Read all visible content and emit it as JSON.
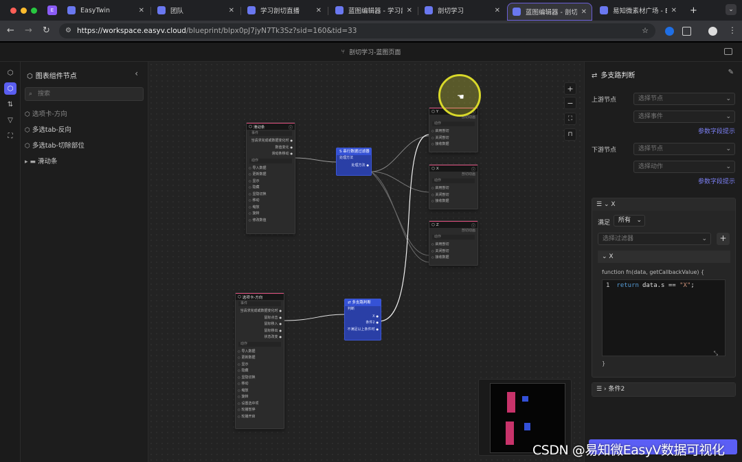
{
  "browser": {
    "tabs": [
      {
        "title": "",
        "favicon_text": "E",
        "favicon_color": "#8b5cf6"
      },
      {
        "title": "EasyTwin",
        "favicon_text": "",
        "favicon_color": "#6a78f0"
      },
      {
        "title": "团队",
        "favicon_text": "",
        "favicon_color": "#6a78f0"
      },
      {
        "title": "学习剖切直播",
        "favicon_text": "",
        "favicon_color": "#6a78f0"
      },
      {
        "title": "蓝图编辑器 - 学习剖切",
        "favicon_text": "",
        "favicon_color": "#6a78f0"
      },
      {
        "title": "剖切学习",
        "favicon_text": "",
        "favicon_color": "#6a78f0"
      },
      {
        "title": "蓝图编辑器 - 剖切学",
        "favicon_text": "",
        "favicon_color": "#6a78f0"
      },
      {
        "title": "易知微素材广场 - Ea",
        "favicon_text": "",
        "favicon_color": "#6a78f0"
      }
    ],
    "new_tab": "+",
    "url_host": "https://workspace.easyv.cloud",
    "url_rest": "/blueprint/blpx0pJ7jyN7Tk3Sz?sid=160&tid=33"
  },
  "app": {
    "page_title": "剖切学习-蓝图页面",
    "left_panel": {
      "title": "图表组件节点",
      "search_placeholder": "搜索",
      "items": [
        {
          "label": "选项卡-方向"
        },
        {
          "label": "多选tab-反向"
        },
        {
          "label": "多选tab-切除部位"
        },
        {
          "label": "滑动条"
        }
      ]
    },
    "nodes": {
      "slider": {
        "title": "滑动条",
        "events_label": "事件",
        "events": [
          "当请求完成或数据变化时",
          "数值变化",
          "滑动条移动"
        ],
        "actions_label": "动作",
        "actions": [
          "导入数据",
          "更新数据",
          "显示",
          "隐藏",
          "显隐切换",
          "移动",
          "缩放",
          "旋转",
          "修改数值"
        ]
      },
      "tabs": {
        "title": "选项卡-方向",
        "events_label": "事件",
        "events": [
          "当请求完成或数据变化时",
          "鼠标点击",
          "鼠标移入",
          "鼠标移出",
          "状态改变"
        ],
        "actions_label": "动作",
        "actions": [
          "导入数据",
          "更新数据",
          "显示",
          "隐藏",
          "显隐切换",
          "移动",
          "缩放",
          "旋转",
          "设置选中项",
          "轮播暂停",
          "轮播开启"
        ]
      },
      "filter": {
        "title": "串行数据过滤器",
        "in": "处理方法",
        "out": "处理方法"
      },
      "branch": {
        "title": "多支路判断",
        "in": "判断",
        "outs": [
          "X",
          "条件2",
          "不满足以上条件时"
        ]
      },
      "y": {
        "title": "Y",
        "sub": "剖切动画",
        "actions_label": "动作",
        "actions": [
          "启用剖切",
          "关闭剖切",
          "接收数据"
        ]
      },
      "x": {
        "title": "X",
        "sub": "剖切动画",
        "actions_label": "动作",
        "actions": [
          "启用剖切",
          "关闭剖切",
          "接收数据"
        ]
      },
      "z": {
        "title": "Z",
        "sub": "剖切动画",
        "actions_label": "动作",
        "actions": [
          "启用剖切",
          "关闭剖切",
          "接收数据"
        ]
      }
    },
    "right_panel": {
      "title": "多支路判断",
      "upstream_label": "上游节点",
      "upstream_select": "选择节点",
      "upstream_event": "选择事件",
      "param_hint_1": "参数字段提示",
      "downstream_label": "下游节点",
      "downstream_select": "选择节点",
      "downstream_action": "选择动作",
      "param_hint_2": "参数字段提示",
      "condition1": {
        "name": "X",
        "satisfy_label": "满足",
        "satisfy_value": "所有",
        "filter_placeholder": "选择过滤器",
        "sub_name": "X",
        "code_header": "function fn(data, getCallbackValue) {",
        "code_line_no": "1",
        "code_line_kw": "return",
        "code_line_expr": "data.s == ",
        "code_line_str": "\"X\"",
        "code_line_end": ";",
        "code_footer": "}"
      },
      "condition2": {
        "name": "条件2"
      }
    },
    "watermark": "CSDN @易知微EasyV数据可视化"
  },
  "colors": {
    "accent": "#5b5ef5",
    "link": "#7b7ff2",
    "node_blue": "#3552d6",
    "minimap_pink": "#c8336a",
    "minimap_blue": "#3350d8"
  },
  "icons": [
    "search-icon",
    "gear-icon",
    "chevron-left-icon",
    "edit-icon",
    "plus-icon",
    "minus-icon",
    "fullscreen-icon",
    "unlock-icon",
    "drag-icon"
  ]
}
